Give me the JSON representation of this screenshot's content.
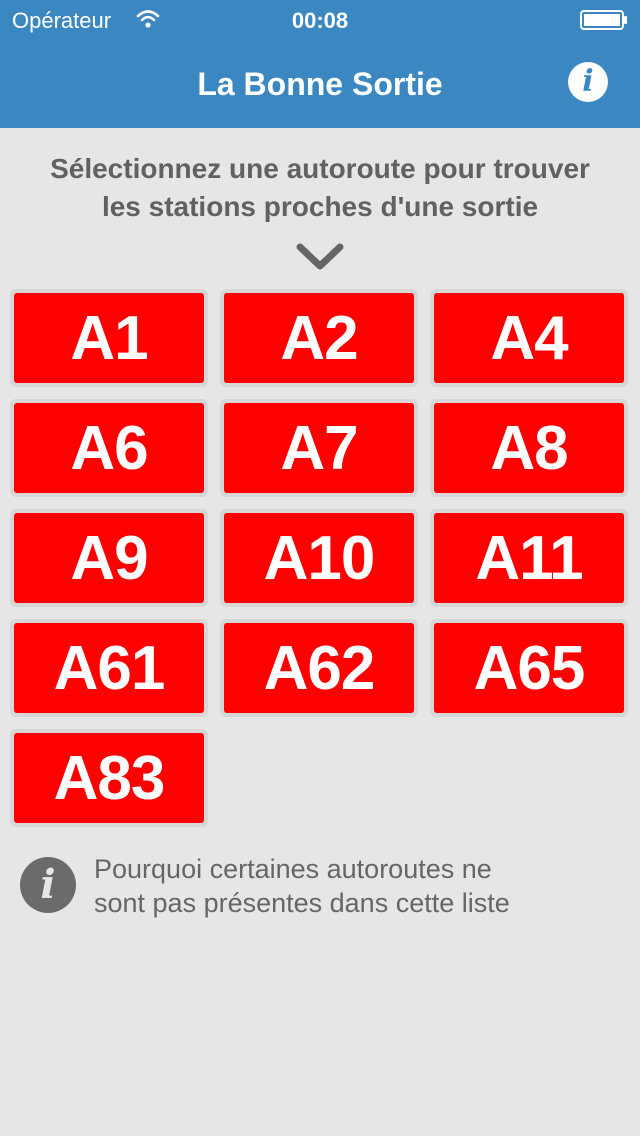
{
  "status_bar": {
    "carrier": "Opérateur",
    "time": "00:08"
  },
  "nav": {
    "title": "La Bonne Sortie",
    "info_icon": "info-icon"
  },
  "prompt": {
    "line1": "Sélectionnez une autoroute pour trouver",
    "line2": "les stations proches d'une sortie",
    "icon": "chevron-down-icon"
  },
  "routes": [
    "A1",
    "A2",
    "A4",
    "A6",
    "A7",
    "A8",
    "A9",
    "A10",
    "A11",
    "A61",
    "A62",
    "A65",
    "A83"
  ],
  "footnote": {
    "icon": "info-icon",
    "line1": "Pourquoi certaines autoroutes ne",
    "line2": "sont pas présentes dans cette liste"
  },
  "colors": {
    "nav_bar": "#3a87c1",
    "background": "#e6e6e6",
    "route_button": "#ff0000",
    "route_border": "#d7d7d7",
    "text_gray": "#616161"
  }
}
